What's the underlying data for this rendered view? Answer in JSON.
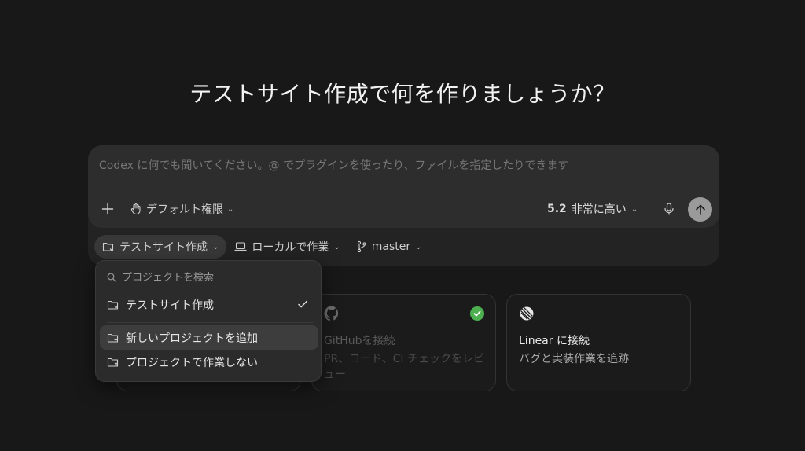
{
  "headline": "テストサイト作成で何を作りましょうか？",
  "composer": {
    "placeholder": "Codex に何でも聞いてください。@ でプラグインを使ったり、ファイルを指定したりできます",
    "permission_label": "デフォルト権限",
    "model_version": "5.2",
    "model_effort": "非常に高い"
  },
  "context": {
    "project_label": "テストサイト作成",
    "environment_label": "ローカルで作業",
    "branch_label": "master"
  },
  "project_menu": {
    "search_placeholder": "プロジェクトを検索",
    "items": [
      {
        "label": "テストサイト作成",
        "selected": true
      },
      {
        "label": "新しいプロジェクトを追加"
      },
      {
        "label": "プロジェクトで作業しない"
      }
    ]
  },
  "cards": [
    {
      "title": "",
      "desc": ""
    },
    {
      "title": "GitHubを接続",
      "desc": "PR、コード、CI チェックをレビュー",
      "connected": true
    },
    {
      "title": "Linear に接続",
      "desc": "バグと実装作業を追跡"
    }
  ],
  "colors": {
    "background": "#181818",
    "composer": "#2d2d2d",
    "success": "#4caf50",
    "send_button": "#9a9a9a"
  }
}
